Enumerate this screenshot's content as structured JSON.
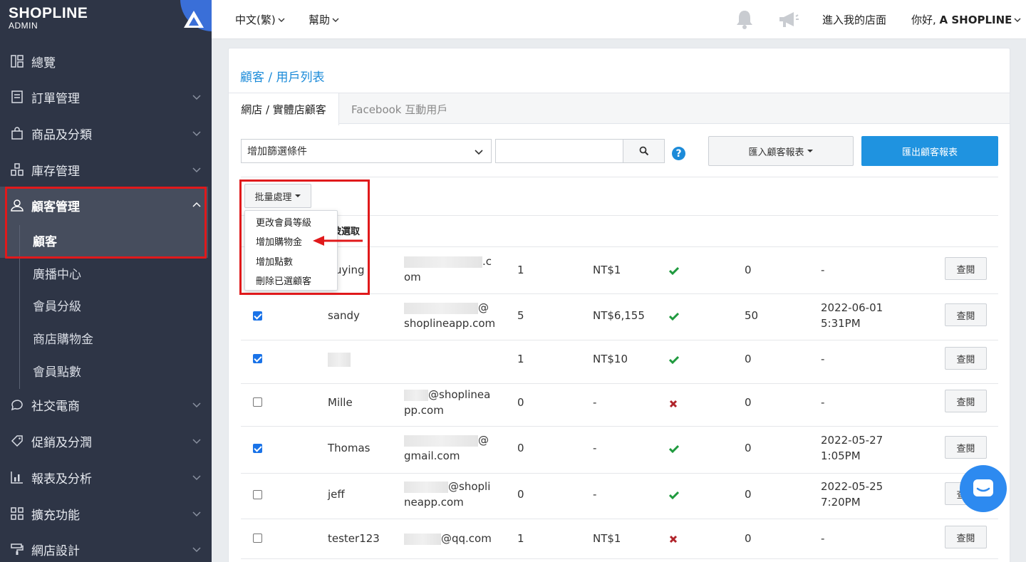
{
  "app": {
    "brand": "SHOPLINE",
    "sub": "ADMIN"
  },
  "sidebar": {
    "items": [
      {
        "label": "總覽",
        "icon": "dashboard-icon"
      },
      {
        "label": "訂單管理",
        "icon": "order-icon"
      },
      {
        "label": "商品及分類",
        "icon": "bag-icon"
      },
      {
        "label": "庫存管理",
        "icon": "inventory-icon"
      },
      {
        "label": "顧客管理",
        "icon": "user-icon"
      },
      {
        "label": "社交電商",
        "icon": "chat-icon"
      },
      {
        "label": "促銷及分潤",
        "icon": "tag-icon"
      },
      {
        "label": "報表及分析",
        "icon": "chart-icon"
      },
      {
        "label": "擴充功能",
        "icon": "apps-icon"
      },
      {
        "label": "網店設計",
        "icon": "paint-icon"
      }
    ],
    "sub_items": [
      "顧客",
      "廣播中心",
      "會員分級",
      "商店購物金",
      "會員點數"
    ]
  },
  "topbar": {
    "language": "中文(繁)",
    "help": "幫助",
    "store_link": "進入我的店面",
    "greeting_prefix": "你好, ",
    "greeting_name": "A SHOPLINE"
  },
  "page": {
    "breadcrumb": "顧客 / 用戶列表",
    "tabs": [
      "網店 / 實體店顧客",
      "Facebook 互動用戶"
    ],
    "filter_placeholder": "增加篩選條件",
    "import_label": "匯入顧客報表",
    "export_label": "匯出顧客報表",
    "bulk_label": "批量處理",
    "bulk_menu": [
      "更改會員等級",
      "增加購物金",
      "增加點數",
      "刪除已選顧客"
    ],
    "selected_label": "已被選取",
    "view_label": "查閱"
  },
  "rows": [
    {
      "checked": false,
      "name": "uying",
      "email_line1": ".c",
      "email_line2": "om",
      "orders": "1",
      "total": "NT$1",
      "status": "check",
      "points": "0",
      "date_line1": "-",
      "date_line2": ""
    },
    {
      "checked": true,
      "name": "sandy",
      "email_line1": "@",
      "email_line2": "shoplineapp.com",
      "orders": "5",
      "total": "NT$6,155",
      "status": "check",
      "points": "50",
      "date_line1": "2022-06-01",
      "date_line2": "5:31PM"
    },
    {
      "checked": true,
      "name": "",
      "email_line1": "",
      "email_line2": "",
      "orders": "1",
      "total": "NT$10",
      "status": "check",
      "points": "0",
      "date_line1": "-",
      "date_line2": ""
    },
    {
      "checked": false,
      "name": "Mille",
      "email_line1": "@shoplinea",
      "email_line2": "pp.com",
      "orders": "0",
      "total": "-",
      "status": "cross",
      "points": "0",
      "date_line1": "-",
      "date_line2": ""
    },
    {
      "checked": true,
      "name": "Thomas",
      "email_line1": "@",
      "email_line2": "gmail.com",
      "orders": "0",
      "total": "-",
      "status": "check",
      "points": "0",
      "date_line1": "2022-05-27",
      "date_line2": "1:05PM"
    },
    {
      "checked": false,
      "name": "jeff",
      "email_line1": "@shopli",
      "email_line2": "neapp.com",
      "orders": "0",
      "total": "-",
      "status": "check",
      "points": "0",
      "date_line1": "2022-05-25",
      "date_line2": "7:20PM"
    },
    {
      "checked": false,
      "name": "tester123",
      "email_line1": "@qq.com",
      "email_line2": "",
      "orders": "1",
      "total": "NT$1",
      "status": "cross",
      "points": "0",
      "date_line1": "-",
      "date_line2": ""
    }
  ],
  "colors": {
    "accent": "#1f93e0",
    "sidebar": "#2e3546",
    "highlight": "#e0191b",
    "check": "#1f9a3e",
    "cross": "#b0232a"
  }
}
